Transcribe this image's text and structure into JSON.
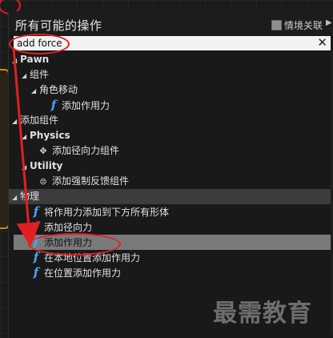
{
  "panel": {
    "title": "所有可能的操作",
    "context_label": "情境关联",
    "context_checked": true
  },
  "search": {
    "value": "add force",
    "clear_glyph": "✕"
  },
  "tree": [
    {
      "label": "Pawn",
      "level": 0,
      "bold": true,
      "kind": "category"
    },
    {
      "label": "组件",
      "level": 1,
      "kind": "category"
    },
    {
      "label": "角色移动",
      "level": 2,
      "kind": "category"
    },
    {
      "label": "添加作用力",
      "level": 3,
      "kind": "function",
      "icon": "function-icon"
    },
    {
      "label": "添加组件",
      "level": 0,
      "kind": "category"
    },
    {
      "label": "Physics",
      "level": 1,
      "bold": true,
      "kind": "category"
    },
    {
      "label": "添加径向力组件",
      "level": 2,
      "kind": "component",
      "icon": "component-icon"
    },
    {
      "label": "Utility",
      "level": 1,
      "bold": true,
      "kind": "category"
    },
    {
      "label": "添加强制反馈组件",
      "level": 2,
      "kind": "component",
      "icon": "gamepad-icon"
    },
    {
      "label": "物理",
      "level": 0,
      "kind": "section"
    },
    {
      "label": "将作用力添加到下方所有形体",
      "level": 1,
      "kind": "function",
      "icon": "function-icon"
    },
    {
      "label": "添加径向力",
      "level": 1,
      "kind": "function",
      "icon": "function-icon"
    },
    {
      "label": "添加作用力",
      "level": 1,
      "kind": "function",
      "icon": "function-icon",
      "selected": true
    },
    {
      "label": "在本地位置添加作用力",
      "level": 1,
      "kind": "function",
      "icon": "function-icon"
    },
    {
      "label": "在位置添加作用力",
      "level": 1,
      "kind": "function",
      "icon": "function-icon"
    }
  ],
  "watermark": "最需教育",
  "annotation_color": "#e02020"
}
